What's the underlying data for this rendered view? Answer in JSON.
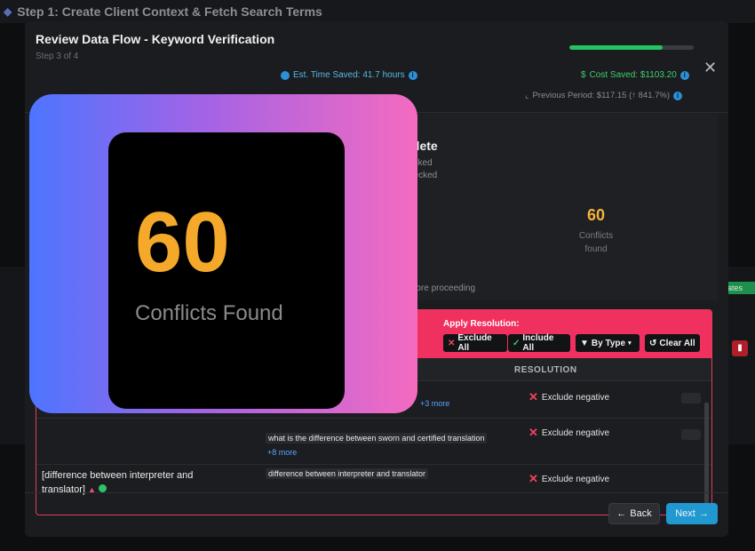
{
  "background": {
    "step1_title": "Step 1: Create Client Context & Fetch Search Terms",
    "badge_fragment": "ates"
  },
  "modal": {
    "title": "Review Data Flow - Keyword Verification",
    "step_indicator": "Step 3 of 4",
    "progress_fraction": 0.75,
    "close_icon": "close-icon",
    "est_time_saved": "Est. Time Saved: 41.7 hours",
    "cost_saved": "Cost Saved: $1103.20",
    "previous_period": "Previous Period: $117.15 (↑ 841.7%)",
    "summary": {
      "title_fragment": "plete",
      "line1_fragment": "ecked",
      "line2_fragment": "hecked",
      "conflicts_value": "60",
      "conflicts_label_1": "Conflicts",
      "conflicts_label_2": "found",
      "before_text": "efore proceeding"
    },
    "apply_resolution": {
      "label": "Apply Resolution:",
      "exclude_all": "Exclude All",
      "include_all": "Include All",
      "by_type": "By Type",
      "clear_all": "Clear All"
    },
    "table": {
      "resolution_header": "RESOLUTION",
      "rows": [
        {
          "more": "+3 more",
          "resolution": "Exclude negative"
        },
        {
          "tag": "what is the difference between sworn and certified translation",
          "more": "+8 more",
          "resolution": "Exclude negative"
        },
        {
          "keyword": "[difference between interpreter and translator]",
          "tag": "difference between interpreter and translator",
          "resolution": "Exclude negative"
        }
      ]
    },
    "footer": {
      "back": "Back",
      "next": "Next"
    }
  },
  "overlay": {
    "number": "60",
    "label": "Conflicts Found"
  },
  "colors": {
    "accent_orange": "#f4a92a",
    "conflict_red": "#f0305f",
    "next_blue": "#2199d0",
    "progress_green": "#22c55e"
  }
}
